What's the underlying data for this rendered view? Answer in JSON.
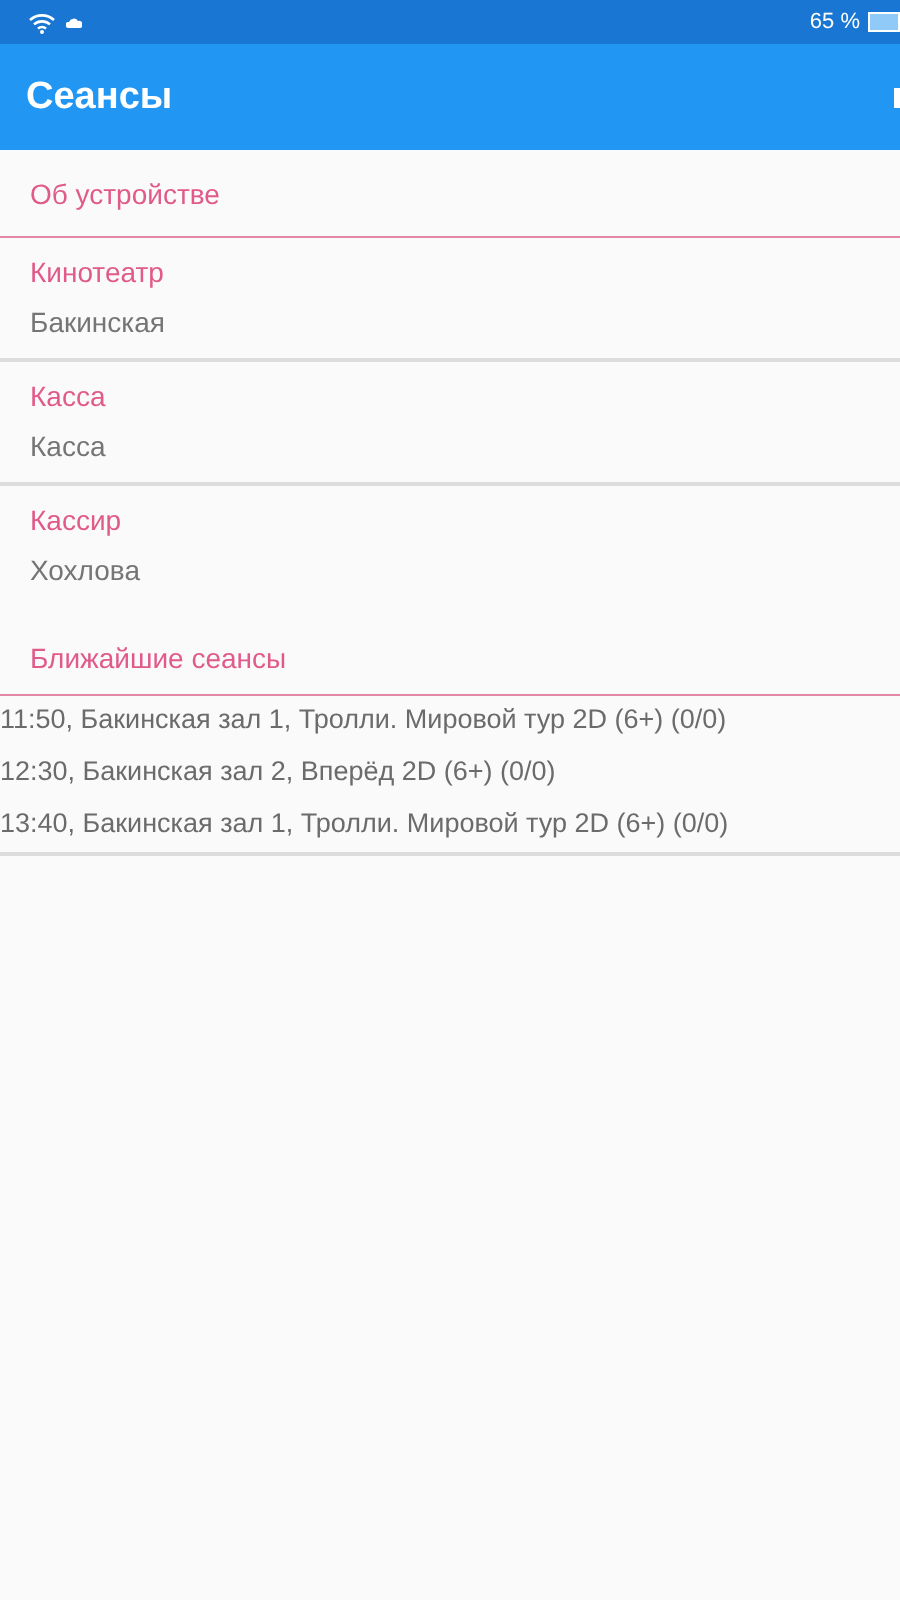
{
  "status_bar": {
    "battery": "65 %"
  },
  "app_bar": {
    "title": "Сеансы"
  },
  "about": {
    "label": "Об устройстве"
  },
  "fields": [
    {
      "label": "Кинотеатр",
      "value": "Бакинская"
    },
    {
      "label": "Касса",
      "value": "Касса"
    },
    {
      "label": "Кассир",
      "value": "Хохлова"
    }
  ],
  "sessions": {
    "header": "Ближайшие сеансы",
    "items": [
      "11:50, Бакинская зал 1, Тролли. Мировой тур 2D (6+) (0/0)",
      "12:30, Бакинская зал 2, Вперёд 2D (6+) (0/0)",
      "13:40, Бакинская зал 1, Тролли. Мировой тур 2D (6+) (0/0)"
    ]
  }
}
